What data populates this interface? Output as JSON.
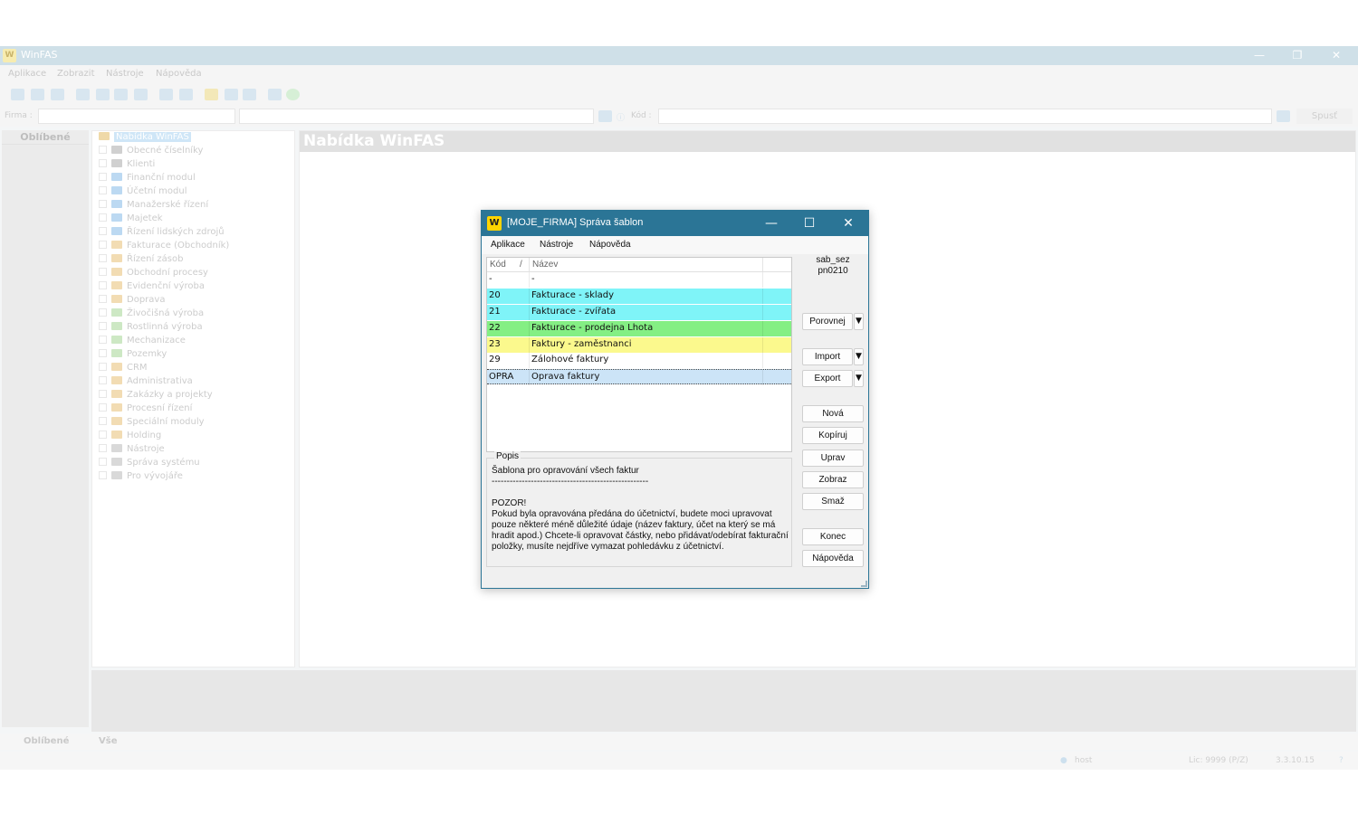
{
  "app": {
    "title": "WinFAS",
    "menu": [
      "Aplikace",
      "Zobrazit",
      "Nástroje",
      "Nápověda"
    ],
    "filter": {
      "firma_label": "Firma :",
      "kod_label": "Kód :",
      "spust_label": "Spusť"
    },
    "favorites_header": "Oblíbené",
    "tree": [
      {
        "label": "Nabídka WinFAS",
        "color": "#cfe6f7"
      },
      {
        "label": "Obecné číselníky",
        "color": "#d0d0d0"
      },
      {
        "label": "Klienti",
        "color": "#d0d0d0"
      },
      {
        "label": "Finanční modul",
        "color": "#bcd9f2"
      },
      {
        "label": "Účetní modul",
        "color": "#bcd9f2"
      },
      {
        "label": "Manažerské řízení",
        "color": "#bcd9f2"
      },
      {
        "label": "Majetek",
        "color": "#bcd9f2"
      },
      {
        "label": "Řízení lidských zdrojů",
        "color": "#bcd9f2"
      },
      {
        "label": "Fakturace (Obchodník)",
        "color": "#f2dcb3"
      },
      {
        "label": "Řízení zásob",
        "color": "#f2dcb3"
      },
      {
        "label": "Obchodní procesy",
        "color": "#f2dcb3"
      },
      {
        "label": "Evidenční výroba",
        "color": "#f2dcb3"
      },
      {
        "label": "Doprava",
        "color": "#f2dcb3"
      },
      {
        "label": "Živočišná výroba",
        "color": "#cde8c4"
      },
      {
        "label": "Rostlinná výroba",
        "color": "#cde8c4"
      },
      {
        "label": "Mechanizace",
        "color": "#cde8c4"
      },
      {
        "label": "Pozemky",
        "color": "#cde8c4"
      },
      {
        "label": "CRM",
        "color": "#f2dcb3"
      },
      {
        "label": "Administrativa",
        "color": "#f2dcb3"
      },
      {
        "label": "Zakázky a projekty",
        "color": "#f2dcb3"
      },
      {
        "label": "Procesní řízení",
        "color": "#f2dcb3"
      },
      {
        "label": "Speciální moduly",
        "color": "#f2dcb3"
      },
      {
        "label": "Holding",
        "color": "#f2dcb3"
      },
      {
        "label": "Nástroje",
        "color": "#d9d9d9"
      },
      {
        "label": "Správa systému",
        "color": "#d9d9d9"
      },
      {
        "label": "Pro vývojáře",
        "color": "#d9d9d9"
      }
    ],
    "content_header": "Nabídka WinFAS",
    "bottom_tabs": [
      "Oblíbené",
      "Vše"
    ],
    "status": {
      "user": "host",
      "license": "Lic: 9999 (P/Z)",
      "version": "3.3.10.15"
    }
  },
  "dialog": {
    "title": "[MOJE_FIRMA] Správa šablon",
    "menu": [
      "Aplikace",
      "Nástroje",
      "Nápověda"
    ],
    "columns": {
      "kod": "Kód",
      "sort_indicator": "/",
      "nazev": "Název"
    },
    "rows": [
      {
        "kod": "-",
        "nazev": "-",
        "color": "#ffffff"
      },
      {
        "kod": "20",
        "nazev": "Fakturace - sklady",
        "color": "#7ff4f8"
      },
      {
        "kod": "21",
        "nazev": "Fakturace - zvířata",
        "color": "#7ff4f8"
      },
      {
        "kod": "22",
        "nazev": "Fakturace - prodejna Lhota",
        "color": "#84ef84"
      },
      {
        "kod": "23",
        "nazev": "Faktury - zaměstnanci",
        "color": "#fbf98d"
      },
      {
        "kod": "29",
        "nazev": "Zálohové faktury",
        "color": "#ffffff"
      },
      {
        "kod": "OPRA",
        "nazev": "Oprava faktury",
        "color": "#cce4f7"
      }
    ],
    "selected_row": 6,
    "popis_label": "Popis",
    "popis_text": "Šablona pro opravování všech faktur\n----------------------------------------------------\n\nPOZOR!\nPokud byla opravována předána do účetnictví, budete moci upravovat pouze některé méně důležité údaje (název faktury, účet na který se má hradit apod.) Chcete-li opravovat částky, nebo přidávat/odebírat fakturační položky, musíte nejdříve vymazat pohledávku z účetnictví.",
    "code_line1": "sab_sez",
    "code_line2": "pn0210",
    "buttons": {
      "porovnej": "Porovnej",
      "import": "Import",
      "export": "Export",
      "nova": "Nová",
      "kopiruj": "Kopíruj",
      "uprav": "Uprav",
      "zobraz": "Zobraz",
      "smaz": "Smaž",
      "konec": "Konec",
      "napoveda": "Nápověda"
    },
    "dropdown_glyph": "▼",
    "colors": {
      "titlebar": "#2b7596",
      "logo": "#ffd400"
    }
  }
}
